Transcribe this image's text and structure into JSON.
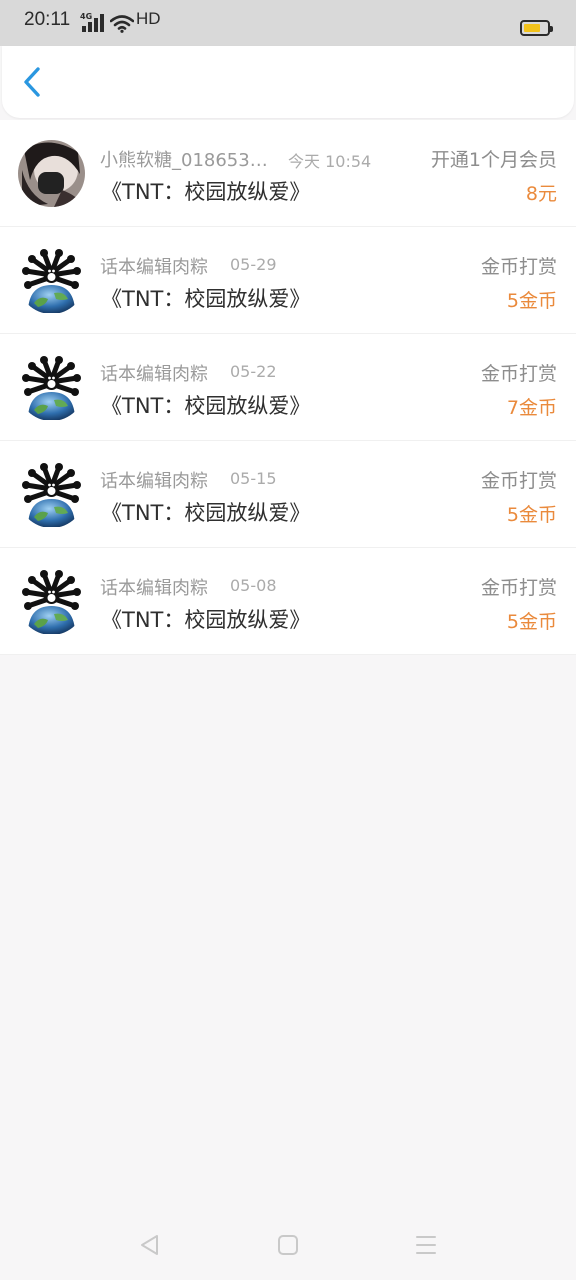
{
  "status_bar": {
    "time": "20:11",
    "network": "4G",
    "hd": "HD",
    "battery_level": 0.6,
    "battery_color": "#f2c21b"
  },
  "header": {
    "back_icon": "chevron-left-icon",
    "accent": "#2a97e0"
  },
  "records": [
    {
      "user": "小熊软糖_018653…",
      "date": "今天 10:54",
      "type": "开通1个月会员",
      "book": "《TNT：校园放纵爱》",
      "amount": "8元",
      "avatar": "user-photo"
    },
    {
      "user": "话本编辑肉粽",
      "date": "05-29",
      "type": "金币打赏",
      "book": "《TNT：校园放纵爱》",
      "amount": "5金币",
      "avatar": "spider-earth-logo"
    },
    {
      "user": "话本编辑肉粽",
      "date": "05-22",
      "type": "金币打赏",
      "book": "《TNT：校园放纵爱》",
      "amount": "7金币",
      "avatar": "spider-earth-logo"
    },
    {
      "user": "话本编辑肉粽",
      "date": "05-15",
      "type": "金币打赏",
      "book": "《TNT：校园放纵爱》",
      "amount": "5金币",
      "avatar": "spider-earth-logo"
    },
    {
      "user": "话本编辑肉粽",
      "date": "05-08",
      "type": "金币打赏",
      "book": "《TNT：校园放纵爱》",
      "amount": "5金币",
      "avatar": "spider-earth-logo"
    }
  ],
  "colors": {
    "amount": "#ea8a3c",
    "background": "#f7f6f7"
  },
  "nav_bar": {
    "back": "triangle-back-icon",
    "home": "square-home-icon",
    "menu": "hamburger-menu-icon"
  }
}
